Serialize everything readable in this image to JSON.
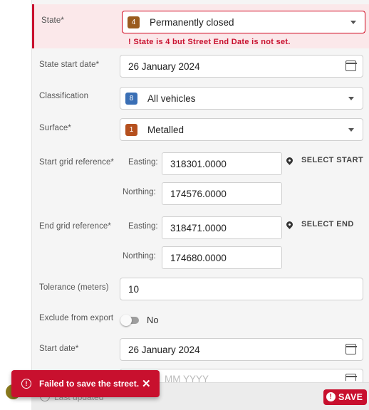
{
  "form": {
    "state": {
      "label": "State*",
      "badge": "4",
      "badge_color": "#9a5b1e",
      "value": "Permanently closed",
      "error": "State is 4 but Street End Date is not set."
    },
    "state_start_date": {
      "label": "State start date*",
      "value": "26 January 2024"
    },
    "classification": {
      "label": "Classification",
      "badge": "8",
      "badge_color": "#3a6fb5",
      "value": "All vehicles"
    },
    "surface": {
      "label": "Surface*",
      "badge": "1",
      "badge_color": "#b5501e",
      "value": "Metalled"
    },
    "start_grid": {
      "label": "Start grid reference*",
      "easting_label": "Easting:",
      "easting": "318301.0000",
      "northing_label": "Northing:",
      "northing": "174576.0000",
      "button": "SELECT START"
    },
    "end_grid": {
      "label": "End grid reference*",
      "easting_label": "Easting:",
      "easting": "318471.0000",
      "northing_label": "Northing:",
      "northing": "174680.0000",
      "button": "SELECT END"
    },
    "tolerance": {
      "label": "Tolerance (meters)",
      "value": "10"
    },
    "exclude_export": {
      "label": "Exclude from export",
      "value": "No"
    },
    "start_date": {
      "label": "Start date*",
      "value": "26 January 2024"
    },
    "next_date": {
      "placeholder": "MM YYYY"
    }
  },
  "footer": {
    "last_updated": "Last updated",
    "save_label": "SAVE"
  },
  "snackbar": {
    "message": "Failed to save the street.",
    "close": "✕",
    "icon": "!"
  },
  "colors": {
    "error": "#c8102e",
    "panel": "#f5f5f5"
  }
}
